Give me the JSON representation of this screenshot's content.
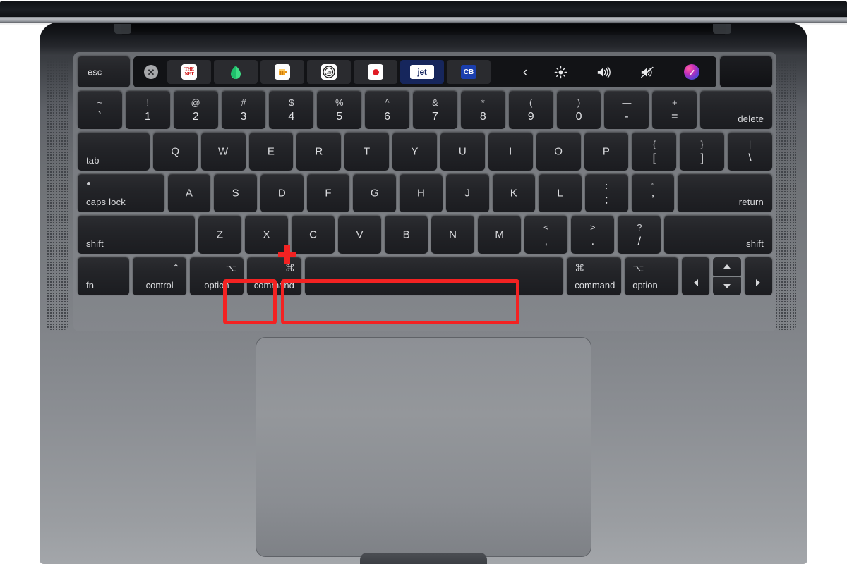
{
  "device": {
    "name": "macbook-pro-keyboard",
    "body_color": "#7e8186",
    "key_color": "#232428",
    "highlight_color": "#f32222"
  },
  "touch_bar": {
    "esc_label": "esc",
    "close_icon": "close-circle-icon",
    "close_glyph": "✕",
    "apps": [
      {
        "name": "net-app-icon",
        "type": "net",
        "line1": "THE",
        "line2": "NET"
      },
      {
        "name": "leaf-app-icon",
        "type": "leaf",
        "color": "#3ddc84"
      },
      {
        "name": "cup-app-icon",
        "type": "cup",
        "color": "#f5a623"
      },
      {
        "name": "badge-app-icon",
        "type": "badge",
        "label": "39"
      },
      {
        "name": "record-app-icon",
        "type": "dot",
        "color": "#e01b24"
      },
      {
        "name": "jet-app-icon",
        "type": "jet",
        "label": "jet",
        "selected": true
      },
      {
        "name": "cb-app-icon",
        "type": "cb",
        "label": "CB"
      }
    ],
    "controls": [
      {
        "name": "expand-chevron-icon",
        "glyph": "‹"
      },
      {
        "name": "brightness-icon",
        "glyph": "brightness"
      },
      {
        "name": "volume-up-icon",
        "glyph": "volume"
      },
      {
        "name": "mute-icon",
        "glyph": "mute"
      },
      {
        "name": "siri-icon",
        "glyph": "siri"
      }
    ]
  },
  "rows": {
    "number": [
      {
        "name": "key-tilde",
        "up": "~",
        "dn": "`",
        "flex": 1
      },
      {
        "name": "key-1",
        "up": "!",
        "dn": "1",
        "flex": 1
      },
      {
        "name": "key-2",
        "up": "@",
        "dn": "2",
        "flex": 1
      },
      {
        "name": "key-3",
        "up": "#",
        "dn": "3",
        "flex": 1
      },
      {
        "name": "key-4",
        "up": "$",
        "dn": "4",
        "flex": 1
      },
      {
        "name": "key-5",
        "up": "%",
        "dn": "5",
        "flex": 1
      },
      {
        "name": "key-6",
        "up": "^",
        "dn": "6",
        "flex": 1
      },
      {
        "name": "key-7",
        "up": "&",
        "dn": "7",
        "flex": 1
      },
      {
        "name": "key-8",
        "up": "*",
        "dn": "8",
        "flex": 1
      },
      {
        "name": "key-9",
        "up": "(",
        "dn": "9",
        "flex": 1
      },
      {
        "name": "key-0",
        "up": ")",
        "dn": "0",
        "flex": 1
      },
      {
        "name": "key-minus",
        "up": "—",
        "dn": "-",
        "flex": 1
      },
      {
        "name": "key-equals",
        "up": "+",
        "dn": "=",
        "flex": 1
      },
      {
        "name": "key-delete",
        "label": "delete",
        "flex": 1.62,
        "align": "br"
      }
    ],
    "top_letters": [
      {
        "name": "key-tab",
        "label": "tab",
        "flex": 1.62,
        "align": "bl"
      },
      {
        "name": "key-q",
        "label": "Q",
        "flex": 1
      },
      {
        "name": "key-w",
        "label": "W",
        "flex": 1
      },
      {
        "name": "key-e",
        "label": "E",
        "flex": 1
      },
      {
        "name": "key-r",
        "label": "R",
        "flex": 1
      },
      {
        "name": "key-t",
        "label": "T",
        "flex": 1
      },
      {
        "name": "key-y",
        "label": "Y",
        "flex": 1
      },
      {
        "name": "key-u",
        "label": "U",
        "flex": 1
      },
      {
        "name": "key-i",
        "label": "I",
        "flex": 1
      },
      {
        "name": "key-o",
        "label": "O",
        "flex": 1
      },
      {
        "name": "key-p",
        "label": "P",
        "flex": 1
      },
      {
        "name": "key-bracket-left",
        "up": "{",
        "dn": "[",
        "flex": 1
      },
      {
        "name": "key-bracket-right",
        "up": "}",
        "dn": "]",
        "flex": 1
      },
      {
        "name": "key-backslash",
        "up": "|",
        "dn": "\\",
        "flex": 1
      }
    ],
    "home_letters": [
      {
        "name": "key-caps-lock",
        "label": "caps lock",
        "flex": 2.02,
        "align": "bl",
        "dot": true
      },
      {
        "name": "key-a",
        "label": "A",
        "flex": 1
      },
      {
        "name": "key-s",
        "label": "S",
        "flex": 1
      },
      {
        "name": "key-d",
        "label": "D",
        "flex": 1
      },
      {
        "name": "key-f",
        "label": "F",
        "flex": 1
      },
      {
        "name": "key-g",
        "label": "G",
        "flex": 1
      },
      {
        "name": "key-h",
        "label": "H",
        "flex": 1
      },
      {
        "name": "key-j",
        "label": "J",
        "flex": 1
      },
      {
        "name": "key-k",
        "label": "K",
        "flex": 1
      },
      {
        "name": "key-l",
        "label": "L",
        "flex": 1
      },
      {
        "name": "key-semicolon",
        "up": ":",
        "dn": ";",
        "flex": 1
      },
      {
        "name": "key-quote",
        "up": "”",
        "dn": "’",
        "flex": 1
      },
      {
        "name": "key-return",
        "label": "return",
        "flex": 2.2,
        "align": "br"
      }
    ],
    "bottom_letters": [
      {
        "name": "key-shift-left",
        "label": "shift",
        "flex": 2.72,
        "align": "bl"
      },
      {
        "name": "key-z",
        "label": "Z",
        "flex": 1
      },
      {
        "name": "key-x",
        "label": "X",
        "flex": 1
      },
      {
        "name": "key-c",
        "label": "C",
        "flex": 1
      },
      {
        "name": "key-v",
        "label": "V",
        "flex": 1
      },
      {
        "name": "key-b",
        "label": "B",
        "flex": 1
      },
      {
        "name": "key-n",
        "label": "N",
        "flex": 1
      },
      {
        "name": "key-m",
        "label": "M",
        "flex": 1
      },
      {
        "name": "key-comma",
        "up": "<",
        "dn": ",",
        "flex": 1
      },
      {
        "name": "key-period",
        "up": ">",
        "dn": ".",
        "flex": 1
      },
      {
        "name": "key-slash",
        "up": "?",
        "dn": "/",
        "flex": 1
      },
      {
        "name": "key-shift-right",
        "label": "shift",
        "flex": 2.5,
        "align": "br"
      }
    ],
    "modifiers": {
      "fn": "fn",
      "control": "control",
      "control_symbol": "⌃",
      "option": "option",
      "option_symbol": "⌥",
      "command": "command",
      "command_symbol": "⌘",
      "space": ""
    }
  },
  "highlights": [
    {
      "name": "command-key-highlight",
      "target": "command",
      "color": "#f32222"
    },
    {
      "name": "space-key-highlight",
      "target": "space",
      "color": "#f32222"
    }
  ],
  "annotation": {
    "plus_name": "plus-sign-annotation",
    "plus_glyph": "+",
    "shortcut": "command + space"
  },
  "trackpad": {
    "name": "trackpad"
  }
}
